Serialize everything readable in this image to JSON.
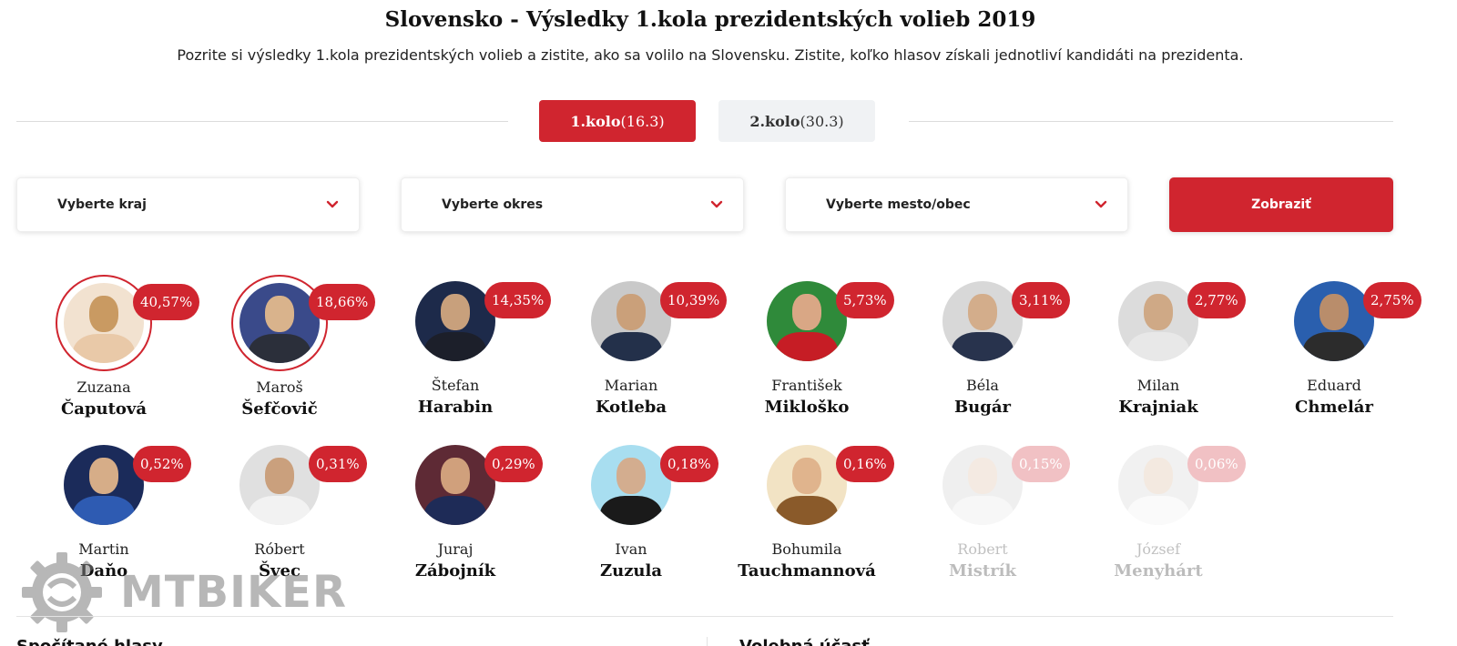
{
  "header": {
    "title": "Slovensko - Výsledky 1.kola prezidentských volieb 2019",
    "subtitle": "Pozrite si výsledky 1.kola prezidentských volieb a zistite, ako sa volilo na Slovensku. Zistite, koľko hlasov získali jednotliví kandidáti na prezidenta."
  },
  "rounds": [
    {
      "label": "1.kolo",
      "date": "(16.3)",
      "active": true
    },
    {
      "label": "2.kolo",
      "date": "(30.3)",
      "active": false
    }
  ],
  "filters": {
    "region": "Vyberte kraj",
    "district": "Vyberte okres",
    "town": "Vyberte mesto/obec",
    "show_label": "Zobraziť"
  },
  "colors": {
    "accent": "#d0252f"
  },
  "candidates": [
    {
      "first": "Zuzana",
      "last": "Čaputová",
      "pct": "40,57%",
      "ringed": true,
      "faded": false
    },
    {
      "first": "Maroš",
      "last": "Šefčovič",
      "pct": "18,66%",
      "ringed": true,
      "faded": false
    },
    {
      "first": "Štefan",
      "last": "Harabin",
      "pct": "14,35%",
      "ringed": false,
      "faded": false
    },
    {
      "first": "Marian",
      "last": "Kotleba",
      "pct": "10,39%",
      "ringed": false,
      "faded": false
    },
    {
      "first": "František",
      "last": "Mikloško",
      "pct": "5,73%",
      "ringed": false,
      "faded": false
    },
    {
      "first": "Béla",
      "last": "Bugár",
      "pct": "3,11%",
      "ringed": false,
      "faded": false
    },
    {
      "first": "Milan",
      "last": "Krajniak",
      "pct": "2,77%",
      "ringed": false,
      "faded": false
    },
    {
      "first": "Eduard",
      "last": "Chmelár",
      "pct": "2,75%",
      "ringed": false,
      "faded": false
    },
    {
      "first": "Martin",
      "last": "Daňo",
      "pct": "0,52%",
      "ringed": false,
      "faded": false
    },
    {
      "first": "Róbert",
      "last": "Švec",
      "pct": "0,31%",
      "ringed": false,
      "faded": false
    },
    {
      "first": "Juraj",
      "last": "Zábojník",
      "pct": "0,29%",
      "ringed": false,
      "faded": false
    },
    {
      "first": "Ivan",
      "last": "Zuzula",
      "pct": "0,18%",
      "ringed": false,
      "faded": false
    },
    {
      "first": "Bohumila",
      "last": "Tauchmannová",
      "pct": "0,16%",
      "ringed": false,
      "faded": false
    },
    {
      "first": "Robert",
      "last": "Mistrík",
      "pct": "0,15%",
      "ringed": false,
      "faded": true
    },
    {
      "first": "József",
      "last": "Menyhárt",
      "pct": "0,06%",
      "ringed": false,
      "faded": true
    }
  ],
  "watermark": {
    "text": "MTBIKER"
  },
  "sections": {
    "counted_votes": "Spočítané hlasy",
    "turnout": "Volebná účasť"
  }
}
